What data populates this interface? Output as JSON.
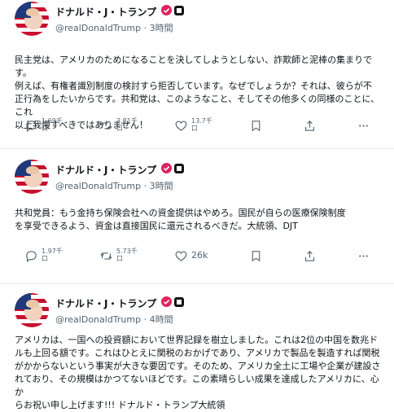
{
  "posts": [
    {
      "display_name": "ドナルド・J・トランプ",
      "handle_time": "@realDonaldTrump · 3時間",
      "lines": [
        "民主党は、アメリカのためになることを決してしようとしない、詐欺師と泥棒の集まりです。",
        "例えば、有権者識別制度の検討すら拒否しています。なぜでしょうか？それは、彼らが不",
        "正行為をしたいからです。共和党は、このようなこと、そしてその他多くの同様のことに、これ",
        "以上我慢すべきではありません！"
      ],
      "counts": {
        "replies": "1.69千\n口",
        "reposts": "3.81千\n口",
        "likes": "13.7千\n口"
      }
    },
    {
      "display_name": "ドナルド・J・トランプ",
      "handle_time": "@realDonaldTrump · 3時間",
      "lines": [
        "共和党員：もう金持ち保険会社への資金提供はやめろ。国民が自らの医療保険制度",
        "を享受できるよう、資金は直接国民に還元されるべきだ。大統領、DJT"
      ],
      "counts": {
        "replies": "1.97千\n口",
        "reposts": "5.73千\n口",
        "likes": "26k"
      }
    },
    {
      "display_name": "ドナルド・J・トランプ",
      "handle_time": "@realDonaldTrump · 4時間",
      "lines": [
        "アメリカは、一国への投資額において世界記録を樹立しました。これは2位の中国を数兆ド",
        "ルも上回る額です。これはひとえに関税のおかげであり、アメリカで製品を製造すれば関税",
        "がかからないという事実が大きな要因です。そのため、アメリカ全土に工場や企業が建設さ",
        "れており、その規模はかつてないほどです。この素晴らしい成果を達成したアメリカに、心か",
        "らお祝い申し上げます!!! ドナルド・トランプ大統領"
      ]
    }
  ],
  "colors": {
    "text": "#0f1419",
    "secondary": "#536471",
    "badge": "#e0245e",
    "divider": "#e7e9ea"
  },
  "icons": [
    "reply-icon",
    "repost-icon",
    "like-icon",
    "bookmark-icon",
    "share-icon",
    "more-icon"
  ]
}
